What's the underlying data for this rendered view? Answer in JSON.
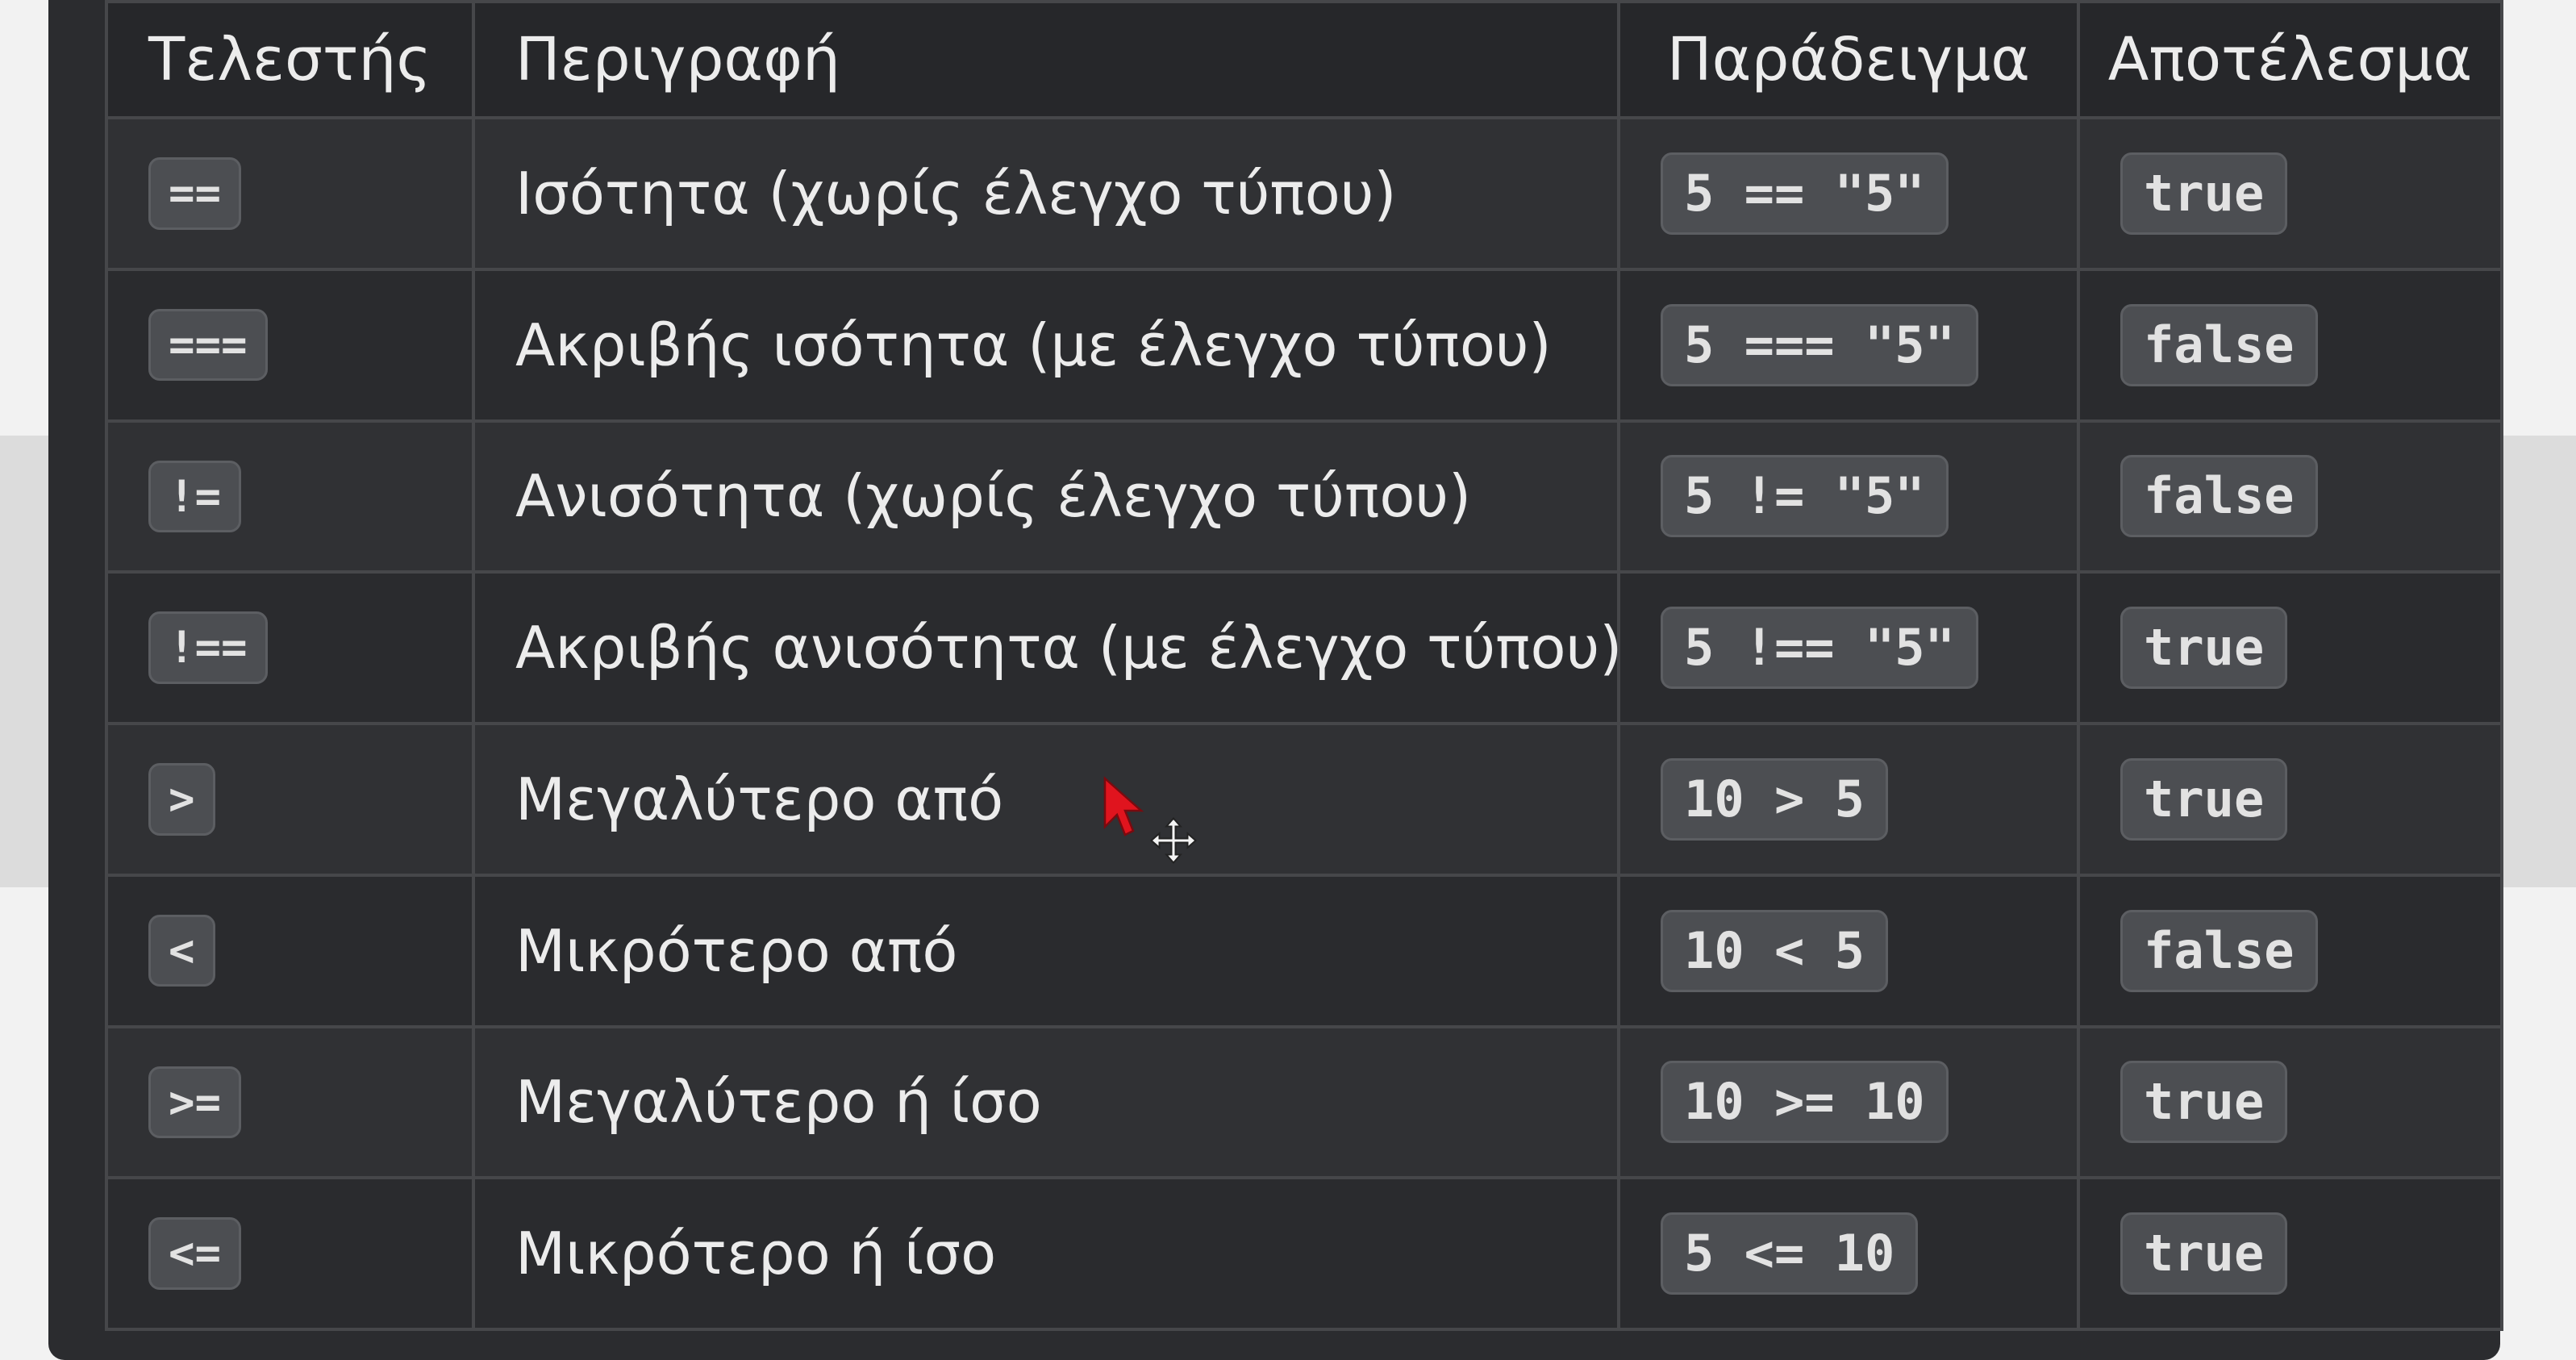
{
  "table": {
    "headers": {
      "operator": "Τελεστής",
      "description": "Περιγραφή",
      "example": "Παράδειγμα",
      "result": "Αποτέλεσμα"
    },
    "rows": [
      {
        "operator": "==",
        "description": "Ισότητα (χωρίς έλεγχο τύπου)",
        "example": "5 == \"5\"",
        "result": "true"
      },
      {
        "operator": "===",
        "description": "Ακριβής ισότητα (με έλεγχο τύπου)",
        "example": "5 === \"5\"",
        "result": "false"
      },
      {
        "operator": "!=",
        "description": "Ανισότητα (χωρίς έλεγχο τύπου)",
        "example": "5 != \"5\"",
        "result": "false"
      },
      {
        "operator": "!==",
        "description": "Ακριβής ανισότητα (με έλεγχο τύπου)",
        "example": "5 !== \"5\"",
        "result": "true"
      },
      {
        "operator": ">",
        "description": "Μεγαλύτερο από",
        "example": "10 > 5",
        "result": "true"
      },
      {
        "operator": "<",
        "description": "Μικρότερο από",
        "example": "10 < 5",
        "result": "false"
      },
      {
        "operator": ">=",
        "description": "Μεγαλύτερο ή ίσο",
        "example": "10 >= 10",
        "result": "true"
      },
      {
        "operator": "<=",
        "description": "Μικρότερο ή ίσο",
        "example": "5 <= 10",
        "result": "true"
      }
    ]
  },
  "colors": {
    "screen_background": "#2b2c2f",
    "header_background": "#26272a",
    "chip_background": "#4c4e52",
    "text": "#ececec",
    "mouse_pointer": "#e0141e"
  },
  "icons": {
    "mouse_pointer": "arrow-pointer-icon",
    "move_cursor": "move-cursor-icon"
  }
}
